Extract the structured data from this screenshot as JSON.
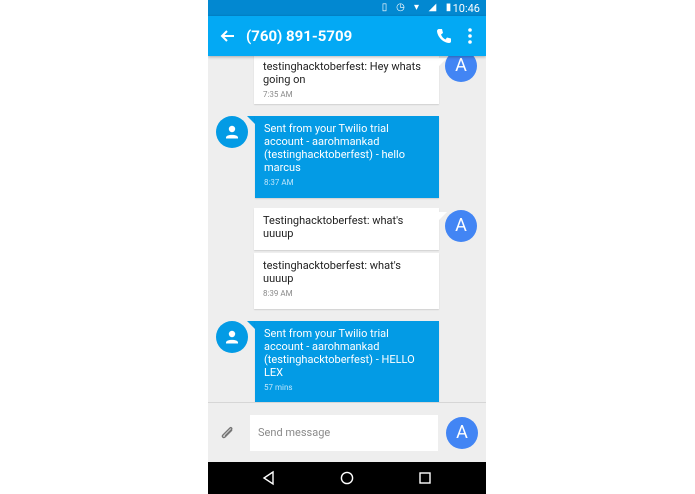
{
  "status": {
    "time": "10:46"
  },
  "appbar": {
    "title": "(760) 891-5709"
  },
  "messages": [
    {
      "text": "testinghacktoberfest: Hey whats going on",
      "time": "7:35 AM",
      "direction": "incoming"
    },
    {
      "text": "Sent from your Twilio trial account - aarohmankad (testinghacktoberfest) - hello marcus",
      "time": "8:37 AM",
      "direction": "outgoing"
    },
    {
      "text": "Testinghacktoberfest: what's uuuup",
      "direction": "incoming"
    },
    {
      "text": "testinghacktoberfest: what's uuuup",
      "time": "8:39 AM",
      "direction": "incoming"
    },
    {
      "text": "Sent from your Twilio trial account - aarohmankad (testinghacktoberfest) - HELLO LEX",
      "time": "57 mins",
      "direction": "outgoing"
    }
  ],
  "contact": {
    "avatar_letter": "A"
  },
  "composer": {
    "placeholder": "Send message"
  },
  "colors": {
    "statusbar": "#0288d1",
    "appbar": "#03a9f4",
    "outgoing": "#039be5",
    "contact_avatar": "#4285f4"
  },
  "icons": [
    "back-arrow-icon",
    "phone-icon",
    "more-vert-icon",
    "person-icon",
    "attach-icon",
    "nav-back-icon",
    "nav-home-icon",
    "nav-recents-icon"
  ]
}
